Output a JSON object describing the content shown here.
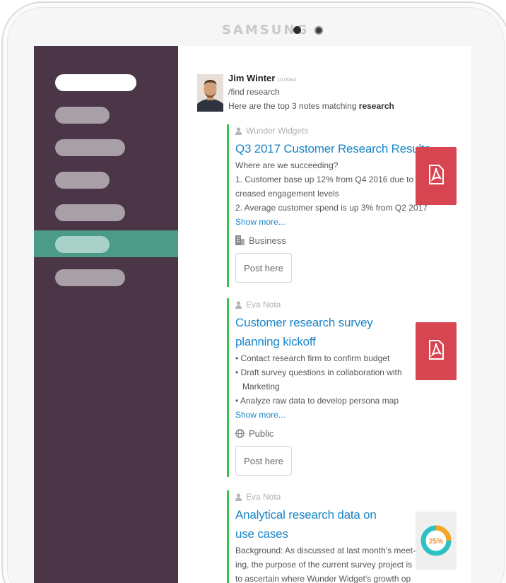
{
  "device": {
    "brand": "SAMSUNG"
  },
  "sidebar": {
    "items": [
      {
        "id": "item-1",
        "active": false
      },
      {
        "id": "item-2",
        "active": false
      },
      {
        "id": "item-3",
        "active": false
      },
      {
        "id": "item-4",
        "active": false
      },
      {
        "id": "item-5",
        "active": false
      },
      {
        "id": "item-6",
        "active": true
      },
      {
        "id": "item-7",
        "active": false
      }
    ]
  },
  "message": {
    "author": "Jim Winter",
    "time": "10:00am",
    "command": "/find research",
    "result_prefix": "Here are the top 3 notes matching ",
    "result_term": "research"
  },
  "cards": [
    {
      "author": "Wunder Widgets",
      "title": "Q3 2017 Customer Research Results",
      "desc": "Where are we succeeding?",
      "lines": [
        "1. Customer base up 12% from Q4 2016 due to in-",
        "creased engagement levels",
        "2. Average customer spend is up 3% from Q2 2017"
      ],
      "show_more": "Show more...",
      "meta_label": "Business",
      "meta_icon": "building-icon",
      "post_label": "Post here",
      "attachment": "pdf-icon"
    },
    {
      "author": "Eva Nota",
      "title_lines": [
        "Customer research survey",
        "planning kickoff"
      ],
      "lines": [
        "• Contact research firm to confirm budget",
        "• Draft survey questions in collaboration with",
        "   Marketing",
        "• Analyze raw data to develop persona map"
      ],
      "show_more": "Show more...",
      "meta_label": "Public",
      "meta_icon": "globe-icon",
      "post_label": "Post here",
      "attachment": "pdf-icon"
    },
    {
      "author": "Eva Nota",
      "title_lines": [
        "Analytical research data on",
        "use cases"
      ],
      "lines": [
        "Background: As discussed at last month's meet-",
        "ing, the purpose of the current survey project is",
        "to ascertain where Wunder Widget's growth op"
      ],
      "attachment": "donut-chart-icon",
      "donut_label": "25%",
      "donut_value": 0.25
    }
  ],
  "colors": {
    "sidebar": "#4a3647",
    "active": "#4c9a88",
    "link": "#1a85c8",
    "accent_bar": "#37c24b",
    "pdf": "#d64550"
  }
}
